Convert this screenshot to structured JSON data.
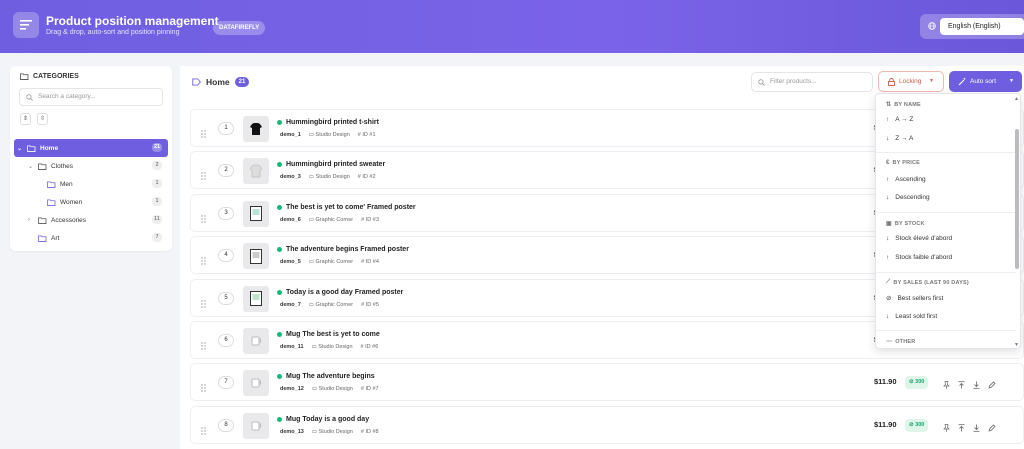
{
  "header": {
    "title": "Product position management",
    "subtitle": "Drag & drop, auto-sort and position pinning",
    "badge": "DATAFIREFLY",
    "language": "English (English)"
  },
  "sidebar": {
    "heading": "CATEGORIES",
    "search_placeholder": "Search a category...",
    "tree": [
      {
        "label": "Home",
        "count": "21",
        "level": 0,
        "active": true
      },
      {
        "label": "Clothes",
        "count": "2",
        "level": 1
      },
      {
        "label": "Men",
        "count": "1",
        "level": 2
      },
      {
        "label": "Women",
        "count": "1",
        "level": 2
      },
      {
        "label": "Accessories",
        "count": "11",
        "level": 1
      },
      {
        "label": "Art",
        "count": "7",
        "level": 1
      }
    ]
  },
  "main": {
    "title": "Home",
    "count": "21",
    "filter_placeholder": "Filter products...",
    "locking_label": "Locking",
    "autosort_label": "Auto sort"
  },
  "products": [
    {
      "pos": "1",
      "name": "Hummingbird printed t-shirt",
      "ref": "demo_1",
      "category": "Studio Design",
      "id": "ID #1",
      "price": "$2"
    },
    {
      "pos": "2",
      "name": "Hummingbird printed sweater",
      "ref": "demo_3",
      "category": "Studio Design",
      "id": "ID #2",
      "price": "$2"
    },
    {
      "pos": "3",
      "name": "The best is yet to come' Framed poster",
      "ref": "demo_6",
      "category": "Graphic Corner",
      "id": "ID #3",
      "price": "$"
    },
    {
      "pos": "4",
      "name": "The adventure begins Framed poster",
      "ref": "demo_5",
      "category": "Graphic Corner",
      "id": "ID #4",
      "price": "$"
    },
    {
      "pos": "5",
      "name": "Today is a good day Framed poster",
      "ref": "demo_7",
      "category": "Graphic Corner",
      "id": "ID #5",
      "price": "$"
    },
    {
      "pos": "6",
      "name": "Mug The best is yet to come",
      "ref": "demo_11",
      "category": "Studio Design",
      "id": "ID #6",
      "price": "$"
    },
    {
      "pos": "7",
      "name": "Mug The adventure begins",
      "ref": "demo_12",
      "category": "Studio Design",
      "id": "ID #7",
      "price": "$11.90",
      "stock": "300"
    },
    {
      "pos": "8",
      "name": "Mug Today is a good day",
      "ref": "demo_13",
      "category": "Studio Design",
      "id": "ID #8",
      "price": "$11.90",
      "stock": "300"
    }
  ],
  "sort_menu": {
    "by_name": "BY NAME",
    "az": "A → Z",
    "za": "Z → A",
    "by_price": "BY PRICE",
    "ascending": "Ascending",
    "descending": "Descending",
    "by_stock": "BY STOCK",
    "stock_high": "Stock élevé d'abord",
    "stock_low": "Stock faible d'abord",
    "by_sales": "BY SALES (LAST 90 DAYS)",
    "best_sellers": "Best sellers first",
    "least_sold": "Least sold first",
    "other": "OTHER"
  },
  "colors": {
    "accent": "#6f5fe0",
    "in_stock": "#17b97a",
    "locking": "#d05a48"
  }
}
